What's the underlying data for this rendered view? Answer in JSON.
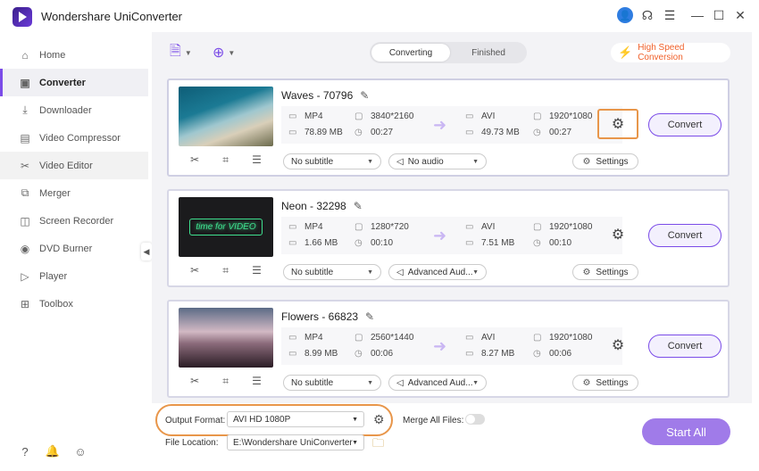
{
  "app": {
    "title": "Wondershare UniConverter"
  },
  "sidebar": {
    "items": [
      {
        "label": "Home",
        "icon": "home-icon",
        "glyph": "⌂"
      },
      {
        "label": "Converter",
        "icon": "converter-icon",
        "glyph": "▣"
      },
      {
        "label": "Downloader",
        "icon": "downloader-icon",
        "glyph": "⤓"
      },
      {
        "label": "Video Compressor",
        "icon": "compress-icon",
        "glyph": "▤"
      },
      {
        "label": "Video Editor",
        "icon": "scissors-icon",
        "glyph": "✂"
      },
      {
        "label": "Merger",
        "icon": "merger-icon",
        "glyph": "⧉"
      },
      {
        "label": "Screen Recorder",
        "icon": "recorder-icon",
        "glyph": "◫"
      },
      {
        "label": "DVD Burner",
        "icon": "disc-icon",
        "glyph": "◉"
      },
      {
        "label": "Player",
        "icon": "player-icon",
        "glyph": "▷"
      },
      {
        "label": "Toolbox",
        "icon": "toolbox-icon",
        "glyph": "⊞"
      }
    ],
    "active": "Converter"
  },
  "tabs": {
    "converting": "Converting",
    "finished": "Finished"
  },
  "high_speed": "High Speed Conversion",
  "files": [
    {
      "name": "Waves - 70796",
      "src": {
        "format": "MP4",
        "res": "3840*2160",
        "size": "78.89 MB",
        "dur": "00:27"
      },
      "dst": {
        "format": "AVI",
        "res": "1920*1080",
        "size": "49.73 MB",
        "dur": "00:27"
      },
      "subtitle": "No subtitle",
      "audio": "No audio",
      "settings": "Settings",
      "convert": "Convert"
    },
    {
      "name": "Neon - 32298",
      "src": {
        "format": "MP4",
        "res": "1280*720",
        "size": "1.66 MB",
        "dur": "00:10"
      },
      "dst": {
        "format": "AVI",
        "res": "1920*1080",
        "size": "7.51 MB",
        "dur": "00:10"
      },
      "subtitle": "No subtitle",
      "audio": "Advanced Aud...",
      "settings": "Settings",
      "convert": "Convert",
      "thumb_text": "time for VIDEO"
    },
    {
      "name": "Flowers - 66823",
      "src": {
        "format": "MP4",
        "res": "2560*1440",
        "size": "8.99 MB",
        "dur": "00:06"
      },
      "dst": {
        "format": "AVI",
        "res": "1920*1080",
        "size": "8.27 MB",
        "dur": "00:06"
      },
      "subtitle": "No subtitle",
      "audio": "Advanced Aud...",
      "settings": "Settings",
      "convert": "Convert"
    }
  ],
  "bottom": {
    "output_format_label": "Output Format:",
    "output_format_value": "AVI HD 1080P",
    "merge_label": "Merge All Files:",
    "file_location_label": "File Location:",
    "file_location_value": "E:\\Wondershare UniConverter",
    "start_all": "Start All"
  },
  "colors": {
    "accent": "#7b4ce8",
    "highlight": "#e8964a",
    "speed": "#f0612b"
  }
}
